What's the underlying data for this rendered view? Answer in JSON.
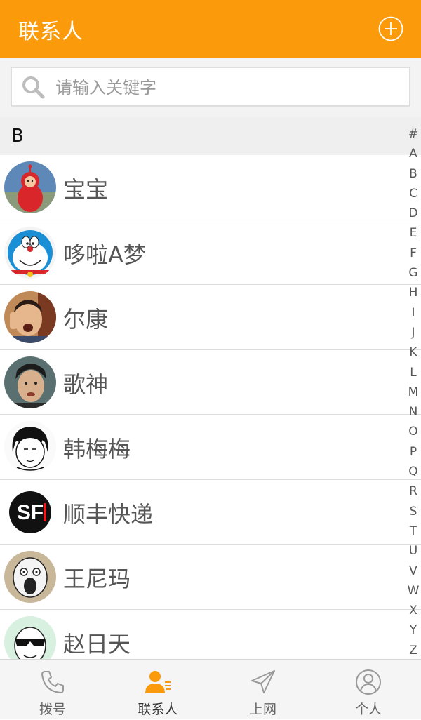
{
  "header": {
    "title": "联系人",
    "add_icon": "plus-circle-icon"
  },
  "search": {
    "placeholder": "请输入关键字",
    "value": ""
  },
  "section": {
    "letter": "B"
  },
  "contacts": [
    {
      "name": "宝宝",
      "avatar": "teletubby-red"
    },
    {
      "name": "哆啦A梦",
      "avatar": "doraemon"
    },
    {
      "name": "尔康",
      "avatar": "erkang"
    },
    {
      "name": "歌神",
      "avatar": "singer"
    },
    {
      "name": "韩梅梅",
      "avatar": "meme-girl"
    },
    {
      "name": "顺丰快递",
      "avatar": "sf-logo"
    },
    {
      "name": "王尼玛",
      "avatar": "wang-nima"
    },
    {
      "name": "赵日天",
      "avatar": "sunglasses-meme"
    }
  ],
  "index": [
    "#",
    "A",
    "B",
    "C",
    "D",
    "E",
    "F",
    "G",
    "H",
    "I",
    "J",
    "K",
    "L",
    "M",
    "N",
    "O",
    "P",
    "Q",
    "R",
    "S",
    "T",
    "U",
    "V",
    "W",
    "X",
    "Y",
    "Z"
  ],
  "tabs": [
    {
      "label": "拨号",
      "icon": "phone-icon"
    },
    {
      "label": "联系人",
      "icon": "contacts-icon",
      "active": true
    },
    {
      "label": "上网",
      "icon": "send-icon"
    },
    {
      "label": "个人",
      "icon": "person-icon"
    }
  ],
  "colors": {
    "accent": "#fb9a0a",
    "text": "#555555",
    "tab_inactive": "#9a9a9a"
  }
}
